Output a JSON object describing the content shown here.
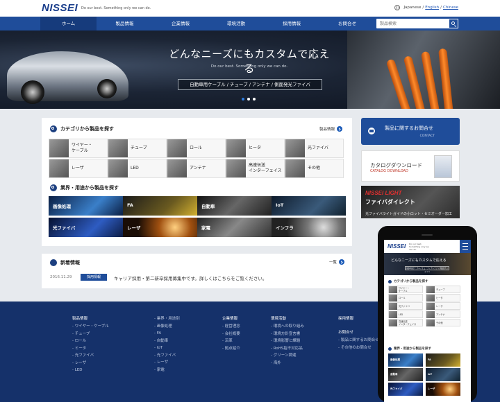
{
  "header": {
    "logo": "NISSEI",
    "tagline": "Do our best.  Something only we can do.",
    "lang": {
      "japanese": "Japanese",
      "sep1": "/",
      "english": "English",
      "sep2": "/",
      "chinese": "Chinese"
    }
  },
  "nav": {
    "items": [
      "ホーム",
      "製品情報",
      "企業情報",
      "環境活動",
      "採用情報",
      "お問合せ"
    ],
    "search_placeholder": "製品検索"
  },
  "hero": {
    "title": "どんなニーズにもカスタムで応える",
    "subtitle": "Do our best. Something only we can do.",
    "caption": "自動車用ケーブル / チューブ / アンテナ / 側面発光ファイバ",
    "slides": 3,
    "active_slide": 1
  },
  "categories": {
    "title": "カテゴリから製品を探す",
    "more": "製品情報",
    "items": [
      [
        "ワイヤー・",
        "ケーブル"
      ],
      [
        "チューブ"
      ],
      [
        "ロール"
      ],
      [
        "ヒータ"
      ],
      [
        "光ファイバ"
      ],
      [
        "レーザ"
      ],
      [
        "LED"
      ],
      [
        "アンテナ"
      ],
      [
        "高速伝送",
        "インターフェイス"
      ],
      [
        "その他"
      ]
    ]
  },
  "industries": {
    "title": "業界・用途から製品を探す",
    "items": [
      "画像処理",
      "FA",
      "自動車",
      "IoT",
      "光ファイバ",
      "レーザ",
      "家電",
      "インフラ"
    ]
  },
  "news": {
    "title": "新着情報",
    "more": "一覧",
    "date": "2016.11.29",
    "tag": "採用情報",
    "text": "キャリア採用・第二新卒採用募集中です。詳しくはこちらをご覧ください。"
  },
  "side": {
    "contact_main": "製品に関するお問合せ",
    "contact_sub": "CONTACT",
    "catalog_main": "カタログダウンロード",
    "catalog_sub": "CATALOG DOWNLOAD",
    "lightway_brand": "NISSEI LIGHT",
    "lightway_title": "ファイバダイレクト",
    "lightway_caption": "光ファイバライトガイドの小ロット・セミオーダー加工"
  },
  "footer": {
    "columns": [
      {
        "head": "製品情報",
        "items": [
          "ワイヤー・ケーブル",
          "チューブ",
          "ロール",
          "ヒータ",
          "光ファイバ",
          "レーザ",
          "LED"
        ]
      },
      {
        "head": "",
        "items": [
          "業界・用途別",
          "画像処理",
          "FA",
          "自動車",
          "IoT",
          "光ファイバ",
          "レーザ",
          "家電"
        ]
      },
      {
        "head": "企業情報",
        "items": [
          "経営理念",
          "会社概要",
          "沿革",
          "拠点紹介"
        ]
      },
      {
        "head": "環境活動",
        "items": [
          "環境への取り組み",
          "環境方針宣言書",
          "環境影響と課題",
          "RoHS指令対応品",
          "グリーン調達",
          "海外"
        ]
      },
      {
        "head": "採用情報",
        "items": []
      },
      {
        "head": "お問合せ",
        "items": [
          "製品に関するお問合せ",
          "その他のお問合せ"
        ]
      }
    ]
  },
  "phone": {
    "logo": "NISSEI",
    "tagline": "Do our best. Something only we can do.",
    "hero_title": "どんなニーズにもカスタムで応える",
    "hero_caption": "自動車用ケーブル / チューブ / アンテナ / 側面発光ファイバ",
    "cat_title": "カテゴリから製品を探す",
    "cats": [
      [
        "ワイヤー・",
        "ケーブル"
      ],
      [
        "チューブ"
      ],
      [
        "ロール"
      ],
      [
        "ヒータ"
      ],
      [
        "光ファイバ"
      ],
      [
        "レーザ"
      ],
      [
        "LED"
      ],
      [
        "アンテナ"
      ],
      [
        "高速伝送",
        "インターフェイス"
      ],
      [
        "その他"
      ]
    ],
    "ind_title": "業界・用途から製品を探す",
    "inds": [
      "画像処理",
      "FA",
      "自動車",
      "IoT",
      "光ファイバ",
      "レーザ"
    ]
  },
  "colors": {
    "brand": "#1f4d9a",
    "footer": "#15316a",
    "accent": "#2d7de0"
  }
}
